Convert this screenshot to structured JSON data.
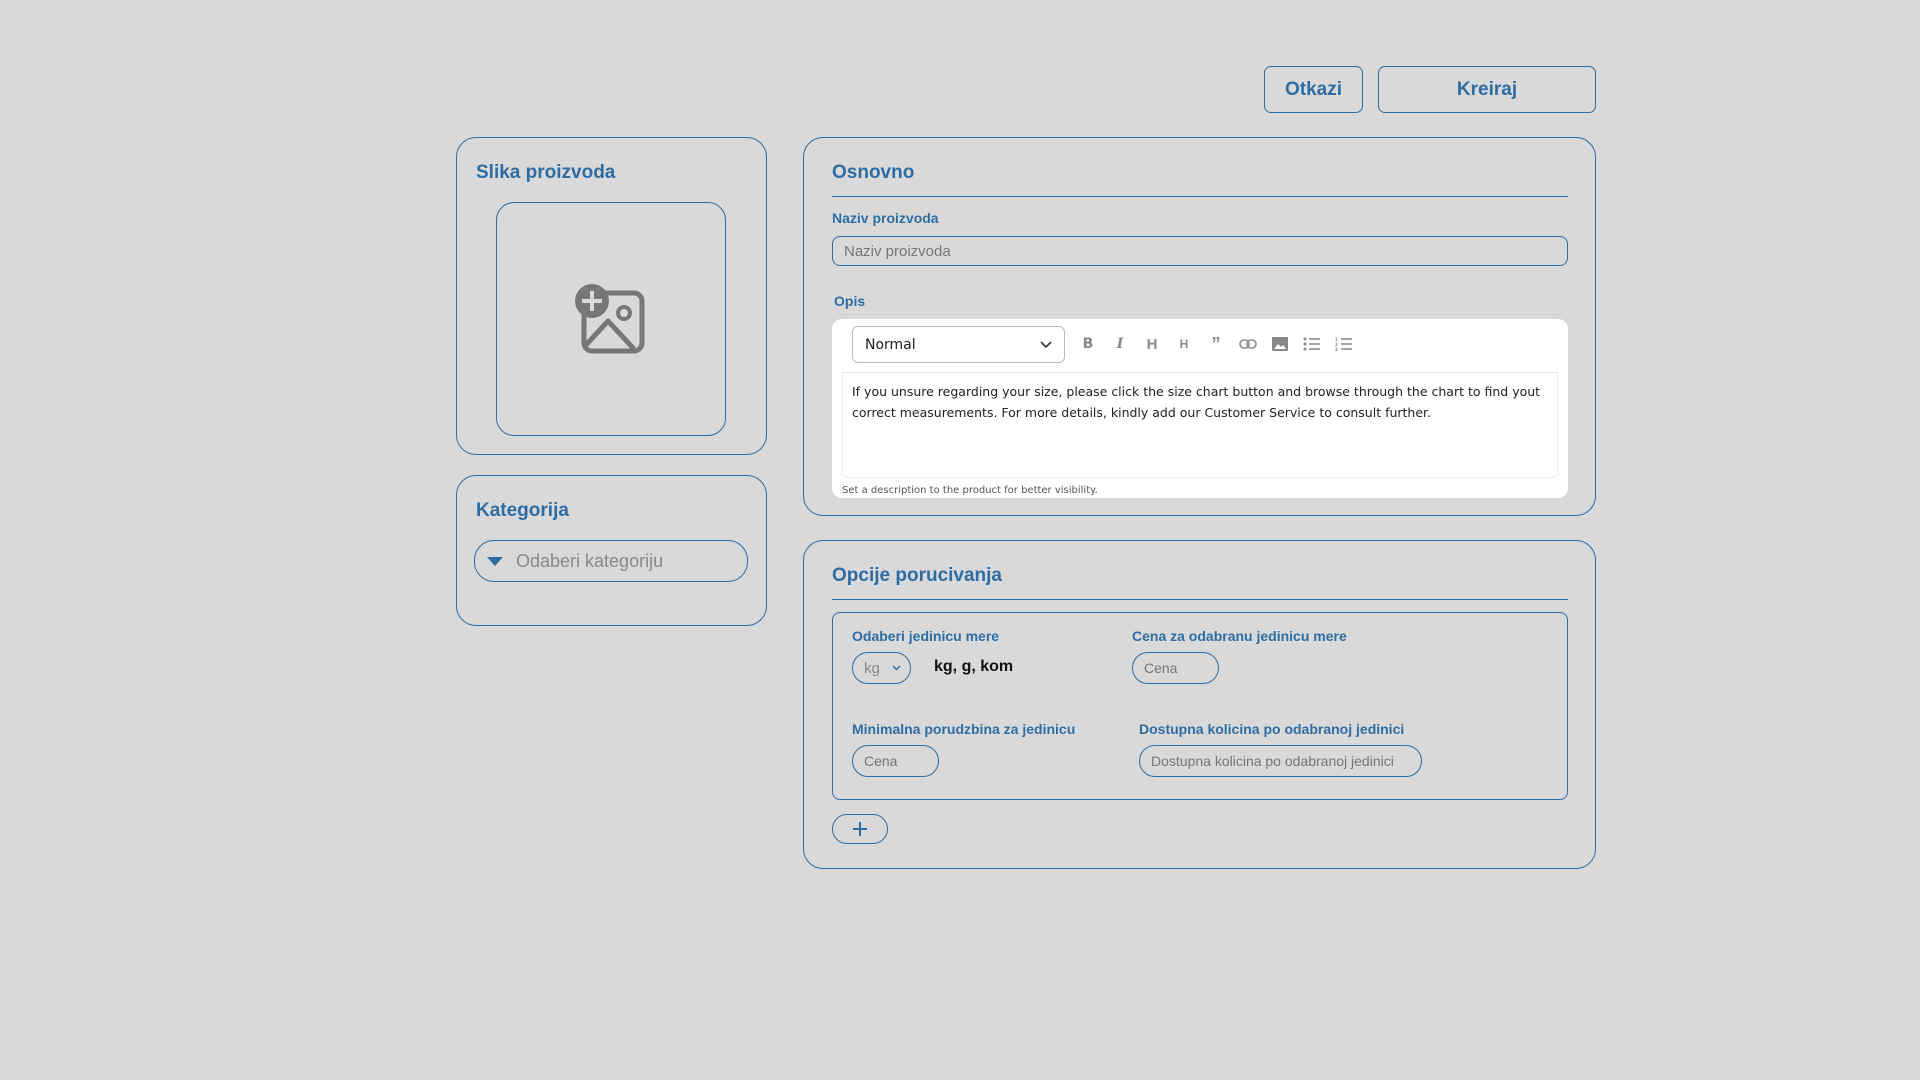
{
  "header": {
    "cancel_label": "Otkazi",
    "create_label": "Kreiraj"
  },
  "image_card": {
    "title": "Slika proizvoda",
    "upload_icon": "add-image-icon"
  },
  "category_card": {
    "title": "Kategorija",
    "select_placeholder": "Odaberi kategoriju"
  },
  "basic_card": {
    "title": "Osnovno",
    "name_label": "Naziv proizvoda",
    "name_placeholder": "Naziv proizvoda",
    "description_label": "Opis",
    "editor": {
      "format_value": "Normal",
      "toolbar_icons": [
        "bold-icon",
        "italic-icon",
        "heading1-icon",
        "heading2-icon",
        "quote-icon",
        "link-icon",
        "image-icon",
        "bullet-list-icon",
        "numbered-list-icon"
      ],
      "content": "If you unsure regarding your size, please click the size chart button and browse through the chart to find yout correct measurements. For more details, kindly add our Customer Service to consult further.",
      "hint": "Set a description to the product for better visibility."
    }
  },
  "order_card": {
    "title": "Opcije porucivanja",
    "unit_label": "Odaberi jedinicu mere",
    "unit_value": "kg",
    "unit_hint": "kg, g, kom",
    "price_label": "Cena za odabranu jedinicu mere",
    "price_placeholder": "Cena",
    "min_order_label": "Minimalna porudzbina za jedinicu",
    "min_order_placeholder": "Cena",
    "available_label": "Dostupna kolicina po odabranoj jedinici",
    "available_placeholder": "Dostupna kolicina po odabranoj jedinici",
    "add_icon": "plus-icon"
  },
  "colors": {
    "accent": "#2e6da4",
    "background": "#d9d9d9",
    "editor_bg": "#ffffff"
  }
}
